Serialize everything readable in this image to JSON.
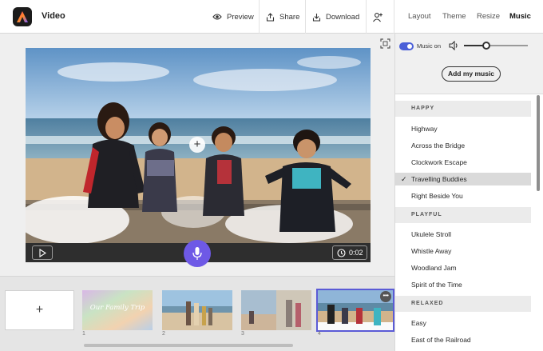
{
  "app": {
    "title": "Video",
    "logo_icon": "adobe-express-logo"
  },
  "header": {
    "actions": [
      {
        "label": "Preview",
        "icon": "eye-icon"
      },
      {
        "label": "Share",
        "icon": "share-icon"
      },
      {
        "label": "Download",
        "icon": "download-icon"
      }
    ],
    "invite_icon": "add-person-icon",
    "tabs": [
      {
        "label": "Layout",
        "active": false
      },
      {
        "label": "Theme",
        "active": false
      },
      {
        "label": "Resize",
        "active": false
      },
      {
        "label": "Music",
        "active": true
      }
    ]
  },
  "player": {
    "time": "0:02",
    "play_icon": "play-icon",
    "mic_icon": "microphone-icon",
    "add_icon": "plus-icon"
  },
  "timeline": {
    "add_label": "+",
    "slides": [
      {
        "number": "1",
        "caption": "Our Family Trip"
      },
      {
        "number": "2",
        "caption": ""
      },
      {
        "number": "3",
        "caption": ""
      },
      {
        "number": "4",
        "caption": "",
        "selected": true
      }
    ],
    "more_label": "•••"
  },
  "music_panel": {
    "toggle_label": "Music on",
    "toggle_on": true,
    "volume_level": 0.35,
    "add_music_label": "Add my music",
    "categories": [
      {
        "name": "HAPPY",
        "tracks": [
          {
            "title": "Highway"
          },
          {
            "title": "Across the Bridge"
          },
          {
            "title": "Clockwork Escape"
          },
          {
            "title": "Travelling Buddies",
            "selected": true
          },
          {
            "title": "Right Beside You"
          }
        ]
      },
      {
        "name": "PLAYFUL",
        "tracks": [
          {
            "title": "Ukulele Stroll"
          },
          {
            "title": "Whistle Away"
          },
          {
            "title": "Woodland Jam"
          },
          {
            "title": "Spirit of the Time"
          }
        ]
      },
      {
        "name": "RELAXED",
        "tracks": [
          {
            "title": "Easy"
          },
          {
            "title": "East of the Railroad"
          }
        ]
      }
    ],
    "selected_check": "✓"
  },
  "colors": {
    "accent": "#6e59e6",
    "toggle": "#4a5fd8",
    "player_bar": "#2e2e2e"
  }
}
